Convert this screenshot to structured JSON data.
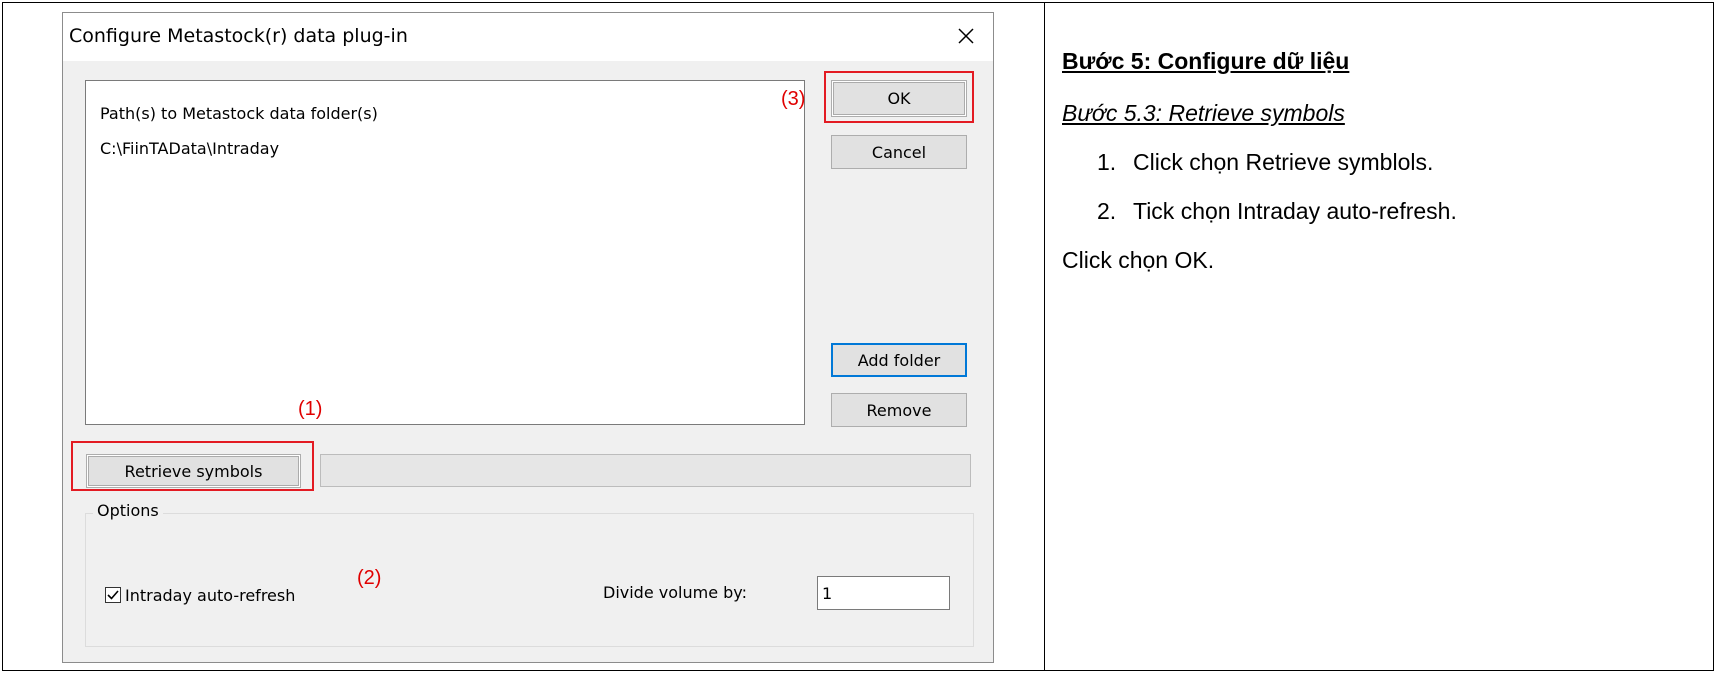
{
  "dialog": {
    "title": "Configure Metastock(r) data plug-in",
    "close_glyph": "close-icon",
    "list_header": "Path(s) to Metastock data folder(s)",
    "list_items": [
      "C:\\FiinTAData\\Intraday"
    ],
    "buttons": {
      "ok": "OK",
      "cancel": "Cancel",
      "add_folder": "Add folder",
      "remove": "Remove",
      "retrieve": "Retrieve symbols"
    },
    "options": {
      "legend": "Options",
      "intraday_label": "Intraday auto-refresh",
      "intraday_checked": true,
      "divide_label": "Divide volume by:",
      "divide_value": "1"
    }
  },
  "annotations": {
    "retrieve": "(1)",
    "intraday": "(2)",
    "ok": "(3)",
    "color": "#e31b23"
  },
  "instructions": {
    "heading": "Bước 5: Configure dữ liệu",
    "subheading": "Bước 5.3: Retrieve symbols",
    "steps": [
      {
        "num": "1.",
        "text": "Click chọn Retrieve symblols."
      },
      {
        "num": "2.",
        "text": "Tick chọn Intraday auto-refresh."
      }
    ],
    "final": "Click chọn OK."
  }
}
